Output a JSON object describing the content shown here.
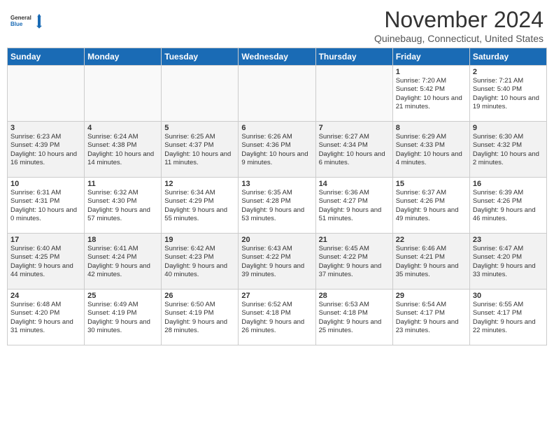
{
  "header": {
    "logo_line1": "General",
    "logo_line2": "Blue",
    "title": "November 2024",
    "subtitle": "Quinebaug, Connecticut, United States"
  },
  "weekdays": [
    "Sunday",
    "Monday",
    "Tuesday",
    "Wednesday",
    "Thursday",
    "Friday",
    "Saturday"
  ],
  "weeks": [
    [
      {
        "day": "",
        "info": "",
        "empty": true
      },
      {
        "day": "",
        "info": "",
        "empty": true
      },
      {
        "day": "",
        "info": "",
        "empty": true
      },
      {
        "day": "",
        "info": "",
        "empty": true
      },
      {
        "day": "",
        "info": "",
        "empty": true
      },
      {
        "day": "1",
        "info": "Sunrise: 7:20 AM\nSunset: 5:42 PM\nDaylight: 10 hours and 21 minutes."
      },
      {
        "day": "2",
        "info": "Sunrise: 7:21 AM\nSunset: 5:40 PM\nDaylight: 10 hours and 19 minutes."
      }
    ],
    [
      {
        "day": "3",
        "info": "Sunrise: 6:23 AM\nSunset: 4:39 PM\nDaylight: 10 hours and 16 minutes."
      },
      {
        "day": "4",
        "info": "Sunrise: 6:24 AM\nSunset: 4:38 PM\nDaylight: 10 hours and 14 minutes."
      },
      {
        "day": "5",
        "info": "Sunrise: 6:25 AM\nSunset: 4:37 PM\nDaylight: 10 hours and 11 minutes."
      },
      {
        "day": "6",
        "info": "Sunrise: 6:26 AM\nSunset: 4:36 PM\nDaylight: 10 hours and 9 minutes."
      },
      {
        "day": "7",
        "info": "Sunrise: 6:27 AM\nSunset: 4:34 PM\nDaylight: 10 hours and 6 minutes."
      },
      {
        "day": "8",
        "info": "Sunrise: 6:29 AM\nSunset: 4:33 PM\nDaylight: 10 hours and 4 minutes."
      },
      {
        "day": "9",
        "info": "Sunrise: 6:30 AM\nSunset: 4:32 PM\nDaylight: 10 hours and 2 minutes."
      }
    ],
    [
      {
        "day": "10",
        "info": "Sunrise: 6:31 AM\nSunset: 4:31 PM\nDaylight: 10 hours and 0 minutes."
      },
      {
        "day": "11",
        "info": "Sunrise: 6:32 AM\nSunset: 4:30 PM\nDaylight: 9 hours and 57 minutes."
      },
      {
        "day": "12",
        "info": "Sunrise: 6:34 AM\nSunset: 4:29 PM\nDaylight: 9 hours and 55 minutes."
      },
      {
        "day": "13",
        "info": "Sunrise: 6:35 AM\nSunset: 4:28 PM\nDaylight: 9 hours and 53 minutes."
      },
      {
        "day": "14",
        "info": "Sunrise: 6:36 AM\nSunset: 4:27 PM\nDaylight: 9 hours and 51 minutes."
      },
      {
        "day": "15",
        "info": "Sunrise: 6:37 AM\nSunset: 4:26 PM\nDaylight: 9 hours and 49 minutes."
      },
      {
        "day": "16",
        "info": "Sunrise: 6:39 AM\nSunset: 4:26 PM\nDaylight: 9 hours and 46 minutes."
      }
    ],
    [
      {
        "day": "17",
        "info": "Sunrise: 6:40 AM\nSunset: 4:25 PM\nDaylight: 9 hours and 44 minutes."
      },
      {
        "day": "18",
        "info": "Sunrise: 6:41 AM\nSunset: 4:24 PM\nDaylight: 9 hours and 42 minutes."
      },
      {
        "day": "19",
        "info": "Sunrise: 6:42 AM\nSunset: 4:23 PM\nDaylight: 9 hours and 40 minutes."
      },
      {
        "day": "20",
        "info": "Sunrise: 6:43 AM\nSunset: 4:22 PM\nDaylight: 9 hours and 39 minutes."
      },
      {
        "day": "21",
        "info": "Sunrise: 6:45 AM\nSunset: 4:22 PM\nDaylight: 9 hours and 37 minutes."
      },
      {
        "day": "22",
        "info": "Sunrise: 6:46 AM\nSunset: 4:21 PM\nDaylight: 9 hours and 35 minutes."
      },
      {
        "day": "23",
        "info": "Sunrise: 6:47 AM\nSunset: 4:20 PM\nDaylight: 9 hours and 33 minutes."
      }
    ],
    [
      {
        "day": "24",
        "info": "Sunrise: 6:48 AM\nSunset: 4:20 PM\nDaylight: 9 hours and 31 minutes."
      },
      {
        "day": "25",
        "info": "Sunrise: 6:49 AM\nSunset: 4:19 PM\nDaylight: 9 hours and 30 minutes."
      },
      {
        "day": "26",
        "info": "Sunrise: 6:50 AM\nSunset: 4:19 PM\nDaylight: 9 hours and 28 minutes."
      },
      {
        "day": "27",
        "info": "Sunrise: 6:52 AM\nSunset: 4:18 PM\nDaylight: 9 hours and 26 minutes."
      },
      {
        "day": "28",
        "info": "Sunrise: 6:53 AM\nSunset: 4:18 PM\nDaylight: 9 hours and 25 minutes."
      },
      {
        "day": "29",
        "info": "Sunrise: 6:54 AM\nSunset: 4:17 PM\nDaylight: 9 hours and 23 minutes."
      },
      {
        "day": "30",
        "info": "Sunrise: 6:55 AM\nSunset: 4:17 PM\nDaylight: 9 hours and 22 minutes."
      }
    ]
  ]
}
